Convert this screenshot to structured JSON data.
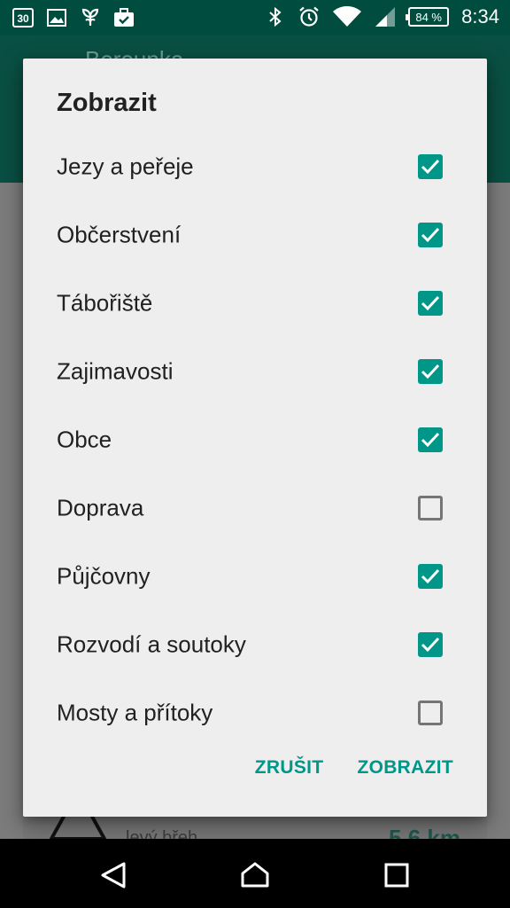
{
  "status_bar": {
    "calendar_day": "30",
    "battery": "84 %",
    "time": "8:34",
    "icons": [
      "calendar-icon",
      "image-icon",
      "plant-icon",
      "briefcase-check-icon",
      "bluetooth-icon",
      "alarm-icon",
      "wifi-icon",
      "signal-icon",
      "battery-icon"
    ]
  },
  "dialog": {
    "title": "Zobrazit",
    "options": [
      {
        "label": "Jezy a peřeje",
        "checked": true
      },
      {
        "label": "Občerstvení",
        "checked": true
      },
      {
        "label": "Tábořiště",
        "checked": true
      },
      {
        "label": "Zajimavosti",
        "checked": true
      },
      {
        "label": "Obce",
        "checked": true
      },
      {
        "label": "Doprava",
        "checked": false
      },
      {
        "label": "Půjčovny",
        "checked": true
      },
      {
        "label": "Rozvodí a soutoky",
        "checked": true
      },
      {
        "label": "Mosty a přítoky",
        "checked": false
      }
    ],
    "cancel_label": "ZRUŠIT",
    "confirm_label": "ZOBRAZIT"
  },
  "background": {
    "app_title": "Berounka",
    "card_subtitle": "levý břeh",
    "card_distance": "5.6 km"
  },
  "nav_bar": {
    "icons": [
      "back-icon",
      "home-icon",
      "recents-icon"
    ]
  },
  "colors": {
    "accent": "#009688",
    "status_bar": "#004c3f",
    "dialog_background": "#eeeeee"
  }
}
